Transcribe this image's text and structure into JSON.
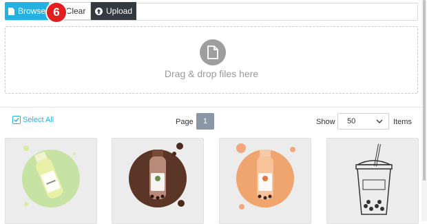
{
  "toolbar": {
    "browse_label": "Browse",
    "clear_label": "Clear",
    "upload_label": "Upload",
    "step_badge": "6",
    "browse_icon": "file-icon",
    "upload_icon": "upload-circle-icon"
  },
  "dropzone": {
    "text": "Drag & drop files here",
    "icon": "file-icon"
  },
  "controls": {
    "select_all_label": "Select All",
    "select_all_checked": true,
    "page_label": "Page",
    "current_page": "1",
    "show_label": "Show",
    "page_size": "50",
    "items_label": "Items"
  },
  "gallery": [
    {
      "name": "green milk bottle",
      "background": "#bfe09a"
    },
    {
      "name": "chocolate milk bottle",
      "background": "#5a3424"
    },
    {
      "name": "orange milk bottle",
      "background": "#f0a878"
    },
    {
      "name": "bubble tea sketch",
      "background": "#ececec"
    }
  ],
  "colors": {
    "accent": "#25b2e3",
    "dark": "#343a40",
    "badge": "#e02020",
    "page_active": "#8b97a6"
  }
}
